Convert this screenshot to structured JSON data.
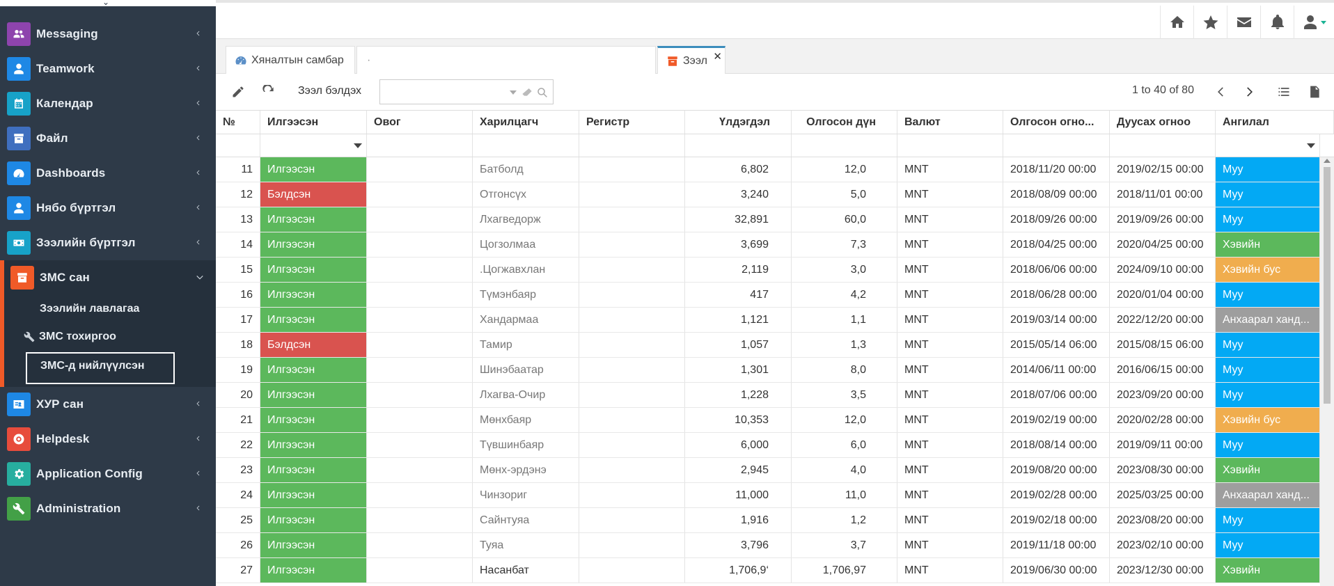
{
  "sidebar": {
    "items": [
      {
        "label": "Messaging",
        "icon": "users-icon",
        "color": "#8e44ad"
      },
      {
        "label": "Teamwork",
        "icon": "user-icon",
        "color": "#1e88e5"
      },
      {
        "label": "Календар",
        "icon": "calendar-icon",
        "color": "#17a2c8"
      },
      {
        "label": "Файл",
        "icon": "archive-icon",
        "color": "#3f6fbf"
      },
      {
        "label": "Dashboards",
        "icon": "dashboard-icon",
        "color": "#1e88e5"
      },
      {
        "label": "Нябо бүртгэл",
        "icon": "user-icon",
        "color": "#1e88e5"
      },
      {
        "label": "Зээлийн бүртгэл",
        "icon": "money-icon",
        "color": "#17a2c8"
      },
      {
        "label": "ЗМС сан",
        "icon": "archive-icon",
        "color": "#f05a28"
      },
      {
        "label": "ХУР сан",
        "icon": "id-card-icon",
        "color": "#1e88e5"
      },
      {
        "label": "Helpdesk",
        "icon": "lifebuoy-icon",
        "color": "#e74c3c"
      },
      {
        "label": "Application Config",
        "icon": "gear-icon",
        "color": "#27ae9f"
      },
      {
        "label": "Administration",
        "icon": "wrench-icon",
        "color": "#43a047"
      }
    ],
    "submenu": [
      "Зээлийн лавлагаа",
      "ЗМС тохиргоо",
      "ЗМС-д нийлүүлсэн"
    ]
  },
  "topbar": {
    "icons": [
      "home-icon",
      "star-icon",
      "envelope-icon",
      "bell-icon",
      "user-icon"
    ]
  },
  "tabs": [
    {
      "label": "Хяналтын самбар",
      "icon": "dashboard-icon"
    },
    {
      "label": "·",
      "icon": ""
    },
    {
      "label": "Зээл",
      "icon": "archive-icon"
    }
  ],
  "toolbar": {
    "label": "Зээл бэлдэх",
    "search_placeholder": "",
    "pager": "1 to 40 of 80"
  },
  "colors": {
    "green": "#5cb85c",
    "red": "#d9534f",
    "blue": "#03a9f4",
    "orange": "#f0ad4e",
    "grey": "#9e9e9e"
  },
  "table": {
    "headers": [
      "№",
      "Илгээсэн",
      "Овог",
      "Харилцагч",
      "Регистр",
      "Үлдэгдэл",
      "Олгосон дүн",
      "Валют",
      "Олгосон огно...",
      "Дуусах огноо",
      "Ангилал"
    ],
    "rows": [
      {
        "no": "11",
        "status": "Илгээсэн",
        "status_color": "green",
        "surname": "",
        "customer": "Батболд",
        "register": "",
        "balance": "6,802",
        "amount": "12,0",
        "currency": "MNT",
        "issued": "2018/11/20 00:00",
        "due": "2019/02/15 00:00",
        "category": "Муу",
        "cat_color": "blue"
      },
      {
        "no": "12",
        "status": "Бэлдсэн",
        "status_color": "red",
        "surname": "",
        "customer": "Отгонсүх",
        "register": "",
        "balance": "3,240",
        "amount": "5,0",
        "currency": "MNT",
        "issued": "2018/08/09 00:00",
        "due": "2018/11/01 00:00",
        "category": "Муу",
        "cat_color": "blue"
      },
      {
        "no": "13",
        "status": "Илгээсэн",
        "status_color": "green",
        "surname": "",
        "customer": "Лхагведорж",
        "register": "",
        "balance": "32,891",
        "amount": "60,0",
        "currency": "MNT",
        "issued": "2018/09/26 00:00",
        "due": "2019/09/26 00:00",
        "category": "Муу",
        "cat_color": "blue"
      },
      {
        "no": "14",
        "status": "Илгээсэн",
        "status_color": "green",
        "surname": "",
        "customer": "Цогзолмаа",
        "register": "",
        "balance": "3,699",
        "amount": "7,3",
        "currency": "MNT",
        "issued": "2018/04/25 00:00",
        "due": "2020/04/25 00:00",
        "category": "Хэвийн",
        "cat_color": "green"
      },
      {
        "no": "15",
        "status": "Илгээсэн",
        "status_color": "green",
        "surname": "",
        "customer": ".Цогжавхлан",
        "register": "",
        "balance": "2,119",
        "amount": "3,0",
        "currency": "MNT",
        "issued": "2018/06/06 00:00",
        "due": "2024/09/10 00:00",
        "category": "Хэвийн бус",
        "cat_color": "orange"
      },
      {
        "no": "16",
        "status": "Илгээсэн",
        "status_color": "green",
        "surname": "",
        "customer": "Түмэнбаяр",
        "register": "",
        "balance": "417",
        "amount": "4,2",
        "currency": "MNT",
        "issued": "2018/06/28 00:00",
        "due": "2020/01/04 00:00",
        "category": "Муу",
        "cat_color": "blue"
      },
      {
        "no": "17",
        "status": "Илгээсэн",
        "status_color": "green",
        "surname": "",
        "customer": "Хандармаа",
        "register": "",
        "balance": "1,121",
        "amount": "1,1",
        "currency": "MNT",
        "issued": "2019/03/14 00:00",
        "due": "2022/12/20 00:00",
        "category": "Анхаарал ханд...",
        "cat_color": "grey"
      },
      {
        "no": "18",
        "status": "Бэлдсэн",
        "status_color": "red",
        "surname": "",
        "customer": "Тамир",
        "register": "",
        "balance": "1,057",
        "amount": "1,3",
        "currency": "MNT",
        "issued": "2015/05/14 06:00",
        "due": "2015/08/15 06:00",
        "category": "Муу",
        "cat_color": "blue"
      },
      {
        "no": "19",
        "status": "Илгээсэн",
        "status_color": "green",
        "surname": "",
        "customer": "Шинэбаатар",
        "register": "",
        "balance": "1,301",
        "amount": "8,0",
        "currency": "MNT",
        "issued": "2014/06/11 00:00",
        "due": "2016/06/15 00:00",
        "category": "Муу",
        "cat_color": "blue"
      },
      {
        "no": "20",
        "status": "Илгээсэн",
        "status_color": "green",
        "surname": "",
        "customer": "Лхагва-Очир",
        "register": "",
        "balance": "1,228",
        "amount": "3,5",
        "currency": "MNT",
        "issued": "2018/07/06 00:00",
        "due": "2023/09/20 00:00",
        "category": "Муу",
        "cat_color": "blue"
      },
      {
        "no": "21",
        "status": "Илгээсэн",
        "status_color": "green",
        "surname": "",
        "customer": "Мөнхбаяр",
        "register": "",
        "balance": "10,353",
        "amount": "12,0",
        "currency": "MNT",
        "issued": "2019/02/19 00:00",
        "due": "2020/02/28 00:00",
        "category": "Хэвийн бус",
        "cat_color": "orange"
      },
      {
        "no": "22",
        "status": "Илгээсэн",
        "status_color": "green",
        "surname": "",
        "customer": "Түвшинбаяр",
        "register": "",
        "balance": "6,000",
        "amount": "6,0",
        "currency": "MNT",
        "issued": "2018/08/14 00:00",
        "due": "2019/09/11 00:00",
        "category": "Муу",
        "cat_color": "blue"
      },
      {
        "no": "23",
        "status": "Илгээсэн",
        "status_color": "green",
        "surname": "",
        "customer": "Мөнх-эрдэнэ",
        "register": "",
        "balance": "2,945",
        "amount": "4,0",
        "currency": "MNT",
        "issued": "2019/08/20 00:00",
        "due": "2023/08/30 00:00",
        "category": "Хэвийн",
        "cat_color": "green"
      },
      {
        "no": "24",
        "status": "Илгээсэн",
        "status_color": "green",
        "surname": "",
        "customer": "Чинзориг",
        "register": "",
        "balance": "11,000",
        "amount": "11,0",
        "currency": "MNT",
        "issued": "2019/02/28 00:00",
        "due": "2025/03/25 00:00",
        "category": "Анхаарал ханд...",
        "cat_color": "grey"
      },
      {
        "no": "25",
        "status": "Илгээсэн",
        "status_color": "green",
        "surname": "",
        "customer": "Сайнтуяа",
        "register": "",
        "balance": "1,916",
        "amount": "1,2",
        "currency": "MNT",
        "issued": "2019/02/18 00:00",
        "due": "2023/08/20 00:00",
        "category": "Муу",
        "cat_color": "blue"
      },
      {
        "no": "26",
        "status": "Илгээсэн",
        "status_color": "green",
        "surname": "",
        "customer": "Туяа",
        "register": "",
        "balance": "3,796",
        "amount": "3,7",
        "currency": "MNT",
        "issued": "2019/11/18 00:00",
        "due": "2023/02/10 00:00",
        "category": "Муу",
        "cat_color": "blue"
      },
      {
        "no": "27",
        "status": "Илгээсэн",
        "status_color": "green",
        "surname": "",
        "customer": "Насанбат",
        "register": "",
        "balance": "1,706,9‘",
        "amount": "1,706,97",
        "currency": "MNT",
        "issued": "2019/06/30 00:00",
        "due": "2023/12/30 00:00",
        "category": "Хэвийн",
        "cat_color": "green"
      }
    ]
  }
}
